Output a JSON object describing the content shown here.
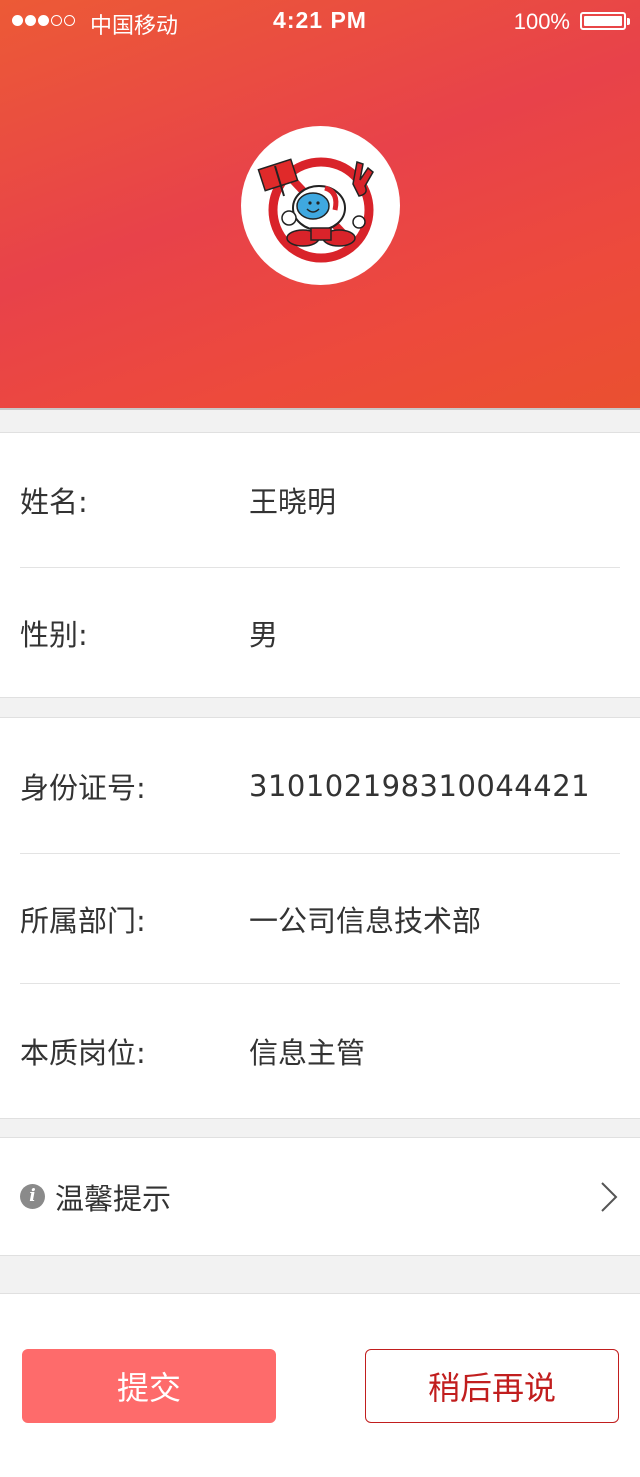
{
  "status_bar": {
    "carrier": "中国移动",
    "time": "4:21 PM",
    "battery": "100%",
    "signal_bars_filled": 3,
    "signal_bars_total": 5
  },
  "profile": {
    "avatar_icon": "mascot-logo"
  },
  "basic_info": {
    "name_label": "姓名:",
    "name_value": "王晓明",
    "gender_label": "性别:",
    "gender_value": "男"
  },
  "work_info": {
    "id_label": "身份证号:",
    "id_value": "310102198310044421",
    "dept_label": "所属部门:",
    "dept_value": "一公司信息技术部",
    "post_label": "本质岗位:",
    "post_value": "信息主管"
  },
  "tips": {
    "icon": "info-icon",
    "label": "温馨提示",
    "arrow_icon": "chevron-right-icon"
  },
  "actions": {
    "submit_label": "提交",
    "later_label": "稍后再说"
  },
  "colors": {
    "header_gradient": [
      "#ec5a36",
      "#e8424a"
    ],
    "submit_bg": "#fe6b6b",
    "later_border": "#c11e1e"
  }
}
